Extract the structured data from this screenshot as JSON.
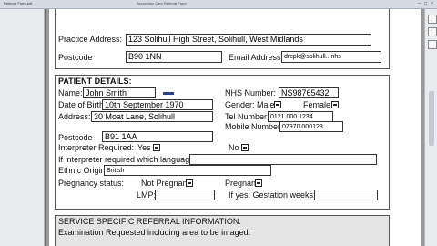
{
  "window": {
    "title": "Referral Form.pdf",
    "subtitle": "Secondary Care Referral Form"
  },
  "practice": {
    "address_label": "Practice Address:",
    "address_value": "123 Solihull High Street, Solihull, West Midlands",
    "postcode_label": "Postcode",
    "postcode_value": "B90 1NN",
    "email_label": "Email Address:",
    "email_value": "drcpk@solihull...nhs"
  },
  "patient": {
    "heading": "PATIENT DETAILS:",
    "name_label": "Name:",
    "name_value": "John Smith",
    "nhs_label": "NHS Number:",
    "nhs_value": "NS98765432",
    "dob_label": "Date of Birth:",
    "dob_value": "10th September 1970",
    "gender_label": "Gender: Male",
    "female_label": "Female",
    "address_label": "Address:",
    "address_value": "30  Moat Lane, Solihull",
    "tel_label": "Tel Number:",
    "tel_value": "0121 000 1234",
    "mobile_label": "Mobile Number:",
    "mobile_value": "07970 000123",
    "postcode_label": "Postcode",
    "postcode_value": "B91 1AA",
    "interp_label": "Interpreter Required:",
    "yes_label": "Yes",
    "no_label": "No",
    "interp_lang_label": "If interpreter required which language:",
    "ethnic_label": "Ethnic Origin:",
    "ethnic_value": "British",
    "preg_label": "Pregnancy status:",
    "not_preg_label": "Not Pregnant",
    "preg_yes_label": "Pregnant",
    "lmp_label": "LMP:",
    "gest_label": "If yes:  Gestation weeks:"
  },
  "service": {
    "heading": "SERVICE SPECIFIC REFERRAL INFORMATION:",
    "exam_label": "Examination Requested including area to be imaged:"
  }
}
